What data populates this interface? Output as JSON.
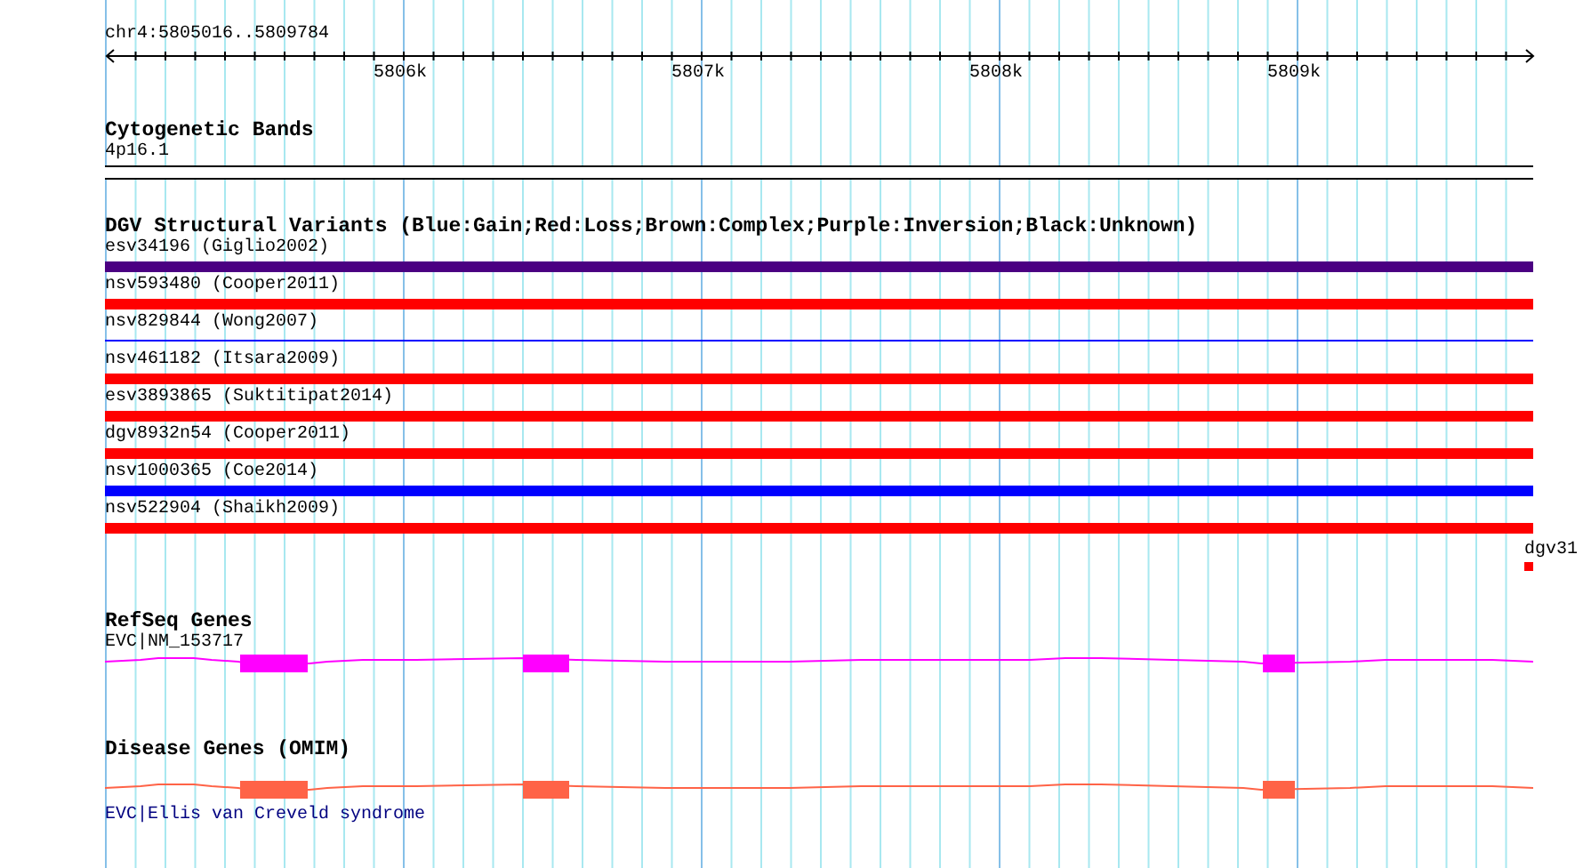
{
  "ruler": {
    "range": "chr4:5805016..5809784",
    "ticks": [
      "5806k",
      "5807k",
      "5808k",
      "5809k"
    ]
  },
  "cytogenetic_bands": {
    "title": "Cytogenetic Bands",
    "band": "4p16.1"
  },
  "dgv": {
    "title": "DGV Structural Variants (Blue:Gain;Red:Loss;Brown:Complex;Purple:Inversion;Black:Unknown)",
    "variants": [
      {
        "label": "esv34196 (Giglio2002)",
        "color": "#4b0082",
        "kind": "bar"
      },
      {
        "label": "nsv593480 (Cooper2011)",
        "color": "#ff0000",
        "kind": "bar"
      },
      {
        "label": "nsv829844 (Wong2007)",
        "color": "#0000ff",
        "kind": "line"
      },
      {
        "label": "nsv461182 (Itsara2009)",
        "color": "#ff0000",
        "kind": "bar"
      },
      {
        "label": "esv3893865 (Suktitipat2014)",
        "color": "#ff0000",
        "kind": "bar"
      },
      {
        "label": "dgv8932n54 (Cooper2011)",
        "color": "#ff0000",
        "kind": "bar"
      },
      {
        "label": "nsv1000365 (Coe2014)",
        "color": "#0000ff",
        "kind": "bar"
      },
      {
        "label": "nsv522904 (Shaikh2009)",
        "color": "#ff0000",
        "kind": "bar"
      }
    ],
    "edge_variant": {
      "label": "dgv31",
      "color": "#ff0000"
    }
  },
  "refseq_genes": {
    "title": "RefSeq Genes",
    "gene": "EVC|NM_153717"
  },
  "disease_genes": {
    "title": "Disease Genes (OMIM)",
    "gene": "EVC|Ellis van Creveld syndrome"
  }
}
